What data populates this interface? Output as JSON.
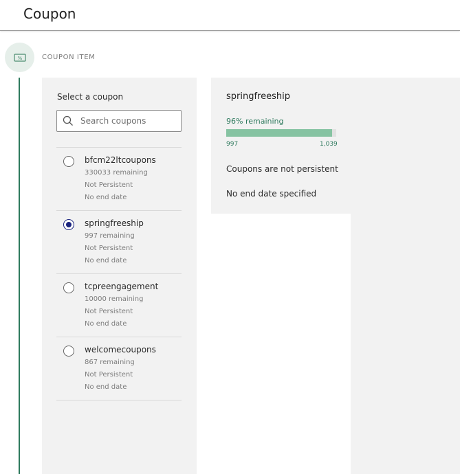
{
  "header": {
    "title": "Coupon"
  },
  "step": {
    "label": "COUPON ITEM",
    "icon": "coupon-ticket-icon"
  },
  "colors": {
    "accent": "#2f7a5e",
    "progress_fill": "#86c3a2",
    "radio_selected": "#1a237e",
    "panel_bg": "#f2f2f2"
  },
  "selector": {
    "label": "Select a coupon",
    "search": {
      "placeholder": "Search coupons",
      "value": "",
      "icon": "search-icon"
    }
  },
  "coupons": [
    {
      "name": "bfcm22ltcoupons",
      "remaining": "330033 remaining",
      "persistence": "Not Persistent",
      "end_date": "No end date",
      "selected": false
    },
    {
      "name": "springfreeship",
      "remaining": "997 remaining",
      "persistence": "Not Persistent",
      "end_date": "No end date",
      "selected": true
    },
    {
      "name": "tcpreengagement",
      "remaining": "10000 remaining",
      "persistence": "Not Persistent",
      "end_date": "No end date",
      "selected": false
    },
    {
      "name": "welcomecoupons",
      "remaining": "867 remaining",
      "persistence": "Not Persistent",
      "end_date": "No end date",
      "selected": false
    }
  ],
  "detail": {
    "title": "springfreeship",
    "percent_label": "96% remaining",
    "progress_fraction": 0.96,
    "count_remaining": "997",
    "count_total": "1,039",
    "persistence_text": "Coupons are not persistent",
    "end_date_text": "No end date specified"
  }
}
